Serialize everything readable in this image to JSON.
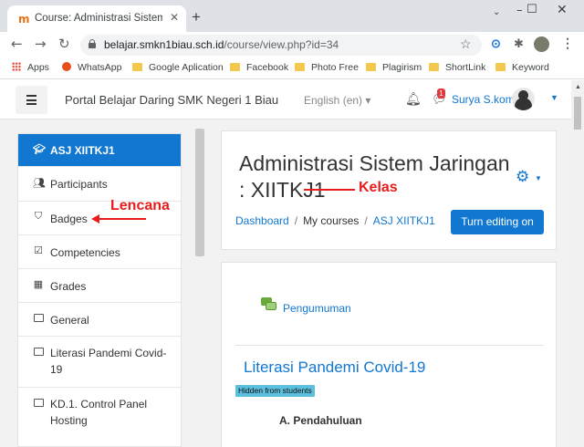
{
  "browser": {
    "tab_title": "Course: Administrasi Sistem Jarin",
    "favicon": "m",
    "url_host": "belajar.smkn1biau.sch.id",
    "url_path": "/course/view.php?id=34",
    "bookmarks": [
      "Apps",
      "WhatsApp",
      "Google Aplication",
      "Facebook",
      "Photo Free",
      "Plagirism",
      "ShortLink",
      "Keyword"
    ]
  },
  "navbar": {
    "site_name": "Portal Belajar Daring SMK Negeri 1 Biau",
    "language": "English (en)",
    "message_count": "1",
    "user_name": "Surya S.kom"
  },
  "drawer": {
    "items": [
      {
        "label": "ASJ XIITKJ1",
        "icon": "graduation-cap-icon"
      },
      {
        "label": "Participants",
        "icon": "users-icon"
      },
      {
        "label": "Badges",
        "icon": "shield-icon"
      },
      {
        "label": "Competencies",
        "icon": "checkbox-icon"
      },
      {
        "label": "Grades",
        "icon": "table-icon"
      },
      {
        "label": "General",
        "icon": "folder-icon"
      },
      {
        "label_lines": [
          "Literasi Pandemi Covid-",
          "19"
        ],
        "icon": "folder-icon"
      },
      {
        "label_lines": [
          "KD.1. Control Panel",
          "Hosting"
        ],
        "icon": "folder-icon"
      }
    ]
  },
  "annotations": {
    "badges_label": "Lencana",
    "course_label": "Kelas"
  },
  "course": {
    "title": "Administrasi Sistem Jaringan : XIITKJ1",
    "breadcrumb": [
      "Dashboard",
      "My courses",
      "ASJ XIITKJ1"
    ],
    "edit_button": "Turn editing on"
  },
  "content": {
    "forum_link": "Pengumuman",
    "section_title": "Literasi Pandemi Covid-19",
    "hidden_badge": "Hidden from students",
    "subheading": "A. Pendahuluan"
  },
  "colors": {
    "accent": "#1177d1",
    "annotation": "#e81c1c",
    "badge_info": "#5bc0de"
  }
}
